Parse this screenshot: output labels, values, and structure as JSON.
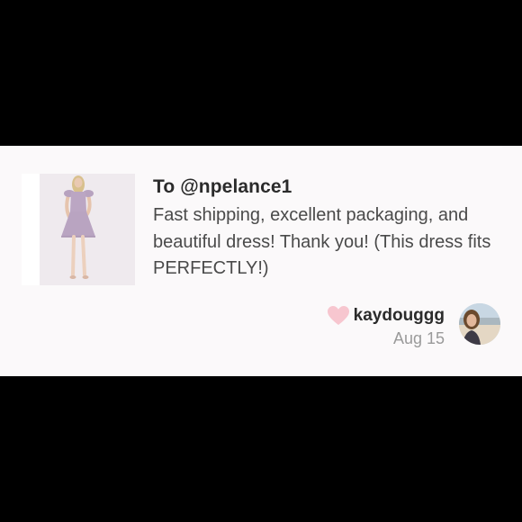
{
  "review": {
    "to_line": "To @npelance1",
    "message": "Fast shipping, excellent packaging, and beautiful dress! Thank you! (This dress fits PERFECTLY!)",
    "author": {
      "username": "kaydouggg",
      "date": "Aug 15"
    },
    "icons": {
      "like": "heart-icon",
      "avatar": "user-avatar"
    }
  },
  "colors": {
    "background": "#000000",
    "card": "#fbf9fa",
    "heart": "#f7c6cf",
    "primary_text": "#2b2b2b",
    "body_text": "#4a4a4a",
    "muted_text": "#9a9a9a"
  }
}
